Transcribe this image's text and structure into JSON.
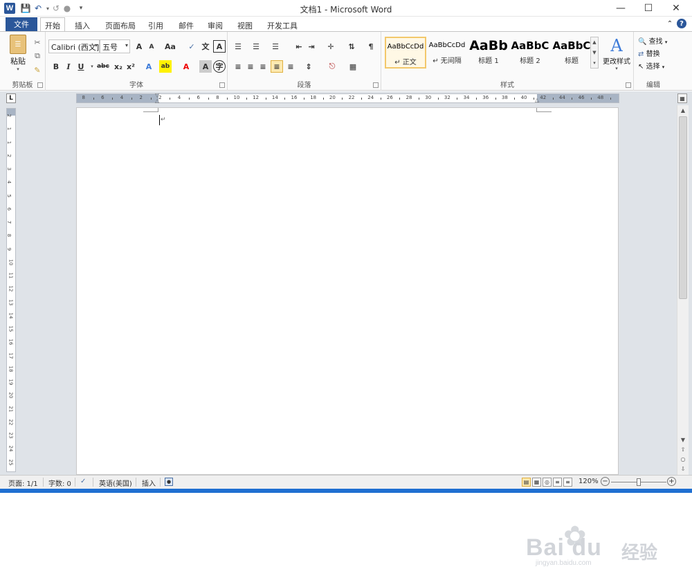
{
  "window": {
    "title": "文档1  -  Microsoft Word",
    "app_icon": "W"
  },
  "quick_access": {
    "items": [
      "save-icon",
      "undo-icon",
      "redo-icon",
      "repeat-icon",
      "customize-icon"
    ]
  },
  "tabs": {
    "file": "文件",
    "items": [
      "开始",
      "插入",
      "页面布局",
      "引用",
      "邮件",
      "审阅",
      "视图",
      "开发工具"
    ],
    "active": 0
  },
  "clipboard": {
    "paste": "粘贴",
    "label": "剪贴板"
  },
  "font": {
    "name": "Calibri (西文]",
    "size": "五号",
    "grow": "A",
    "shrink": "A",
    "case": "Aa",
    "pinyin": "文",
    "bold": "B",
    "italic": "I",
    "underline": "U",
    "strike": "abc",
    "sub": "x₂",
    "sup": "x²",
    "color_a": "A",
    "label": "字体"
  },
  "paragraph": {
    "label": "段落"
  },
  "styles": {
    "items": [
      {
        "preview": "AaBbCcDd",
        "name": "↵ 正文"
      },
      {
        "preview": "AaBbCcDd",
        "name": "↵ 无间隔"
      },
      {
        "preview": "AaBb",
        "name": "标题 1"
      },
      {
        "preview": "AaBbC",
        "name": "标题 2"
      },
      {
        "preview": "AaBbC",
        "name": "标题"
      }
    ],
    "selected": 0,
    "change": "更改样式",
    "label": "样式"
  },
  "editing": {
    "find": "查找",
    "replace": "替换",
    "select": "选择",
    "label": "编辑"
  },
  "ruler": {
    "numbers": [
      "8",
      "6",
      "4",
      "2",
      "2",
      "4",
      "6",
      "8",
      "10",
      "12",
      "14",
      "16",
      "18",
      "20",
      "22",
      "24",
      "26",
      "28",
      "30",
      "32",
      "34",
      "36",
      "38",
      "40",
      "42",
      "44",
      "46",
      "48"
    ],
    "vnumbers": [
      "2",
      "1",
      "1",
      "2",
      "3",
      "4",
      "5",
      "6",
      "7",
      "8",
      "9",
      "10",
      "11",
      "12",
      "13",
      "14",
      "15",
      "16",
      "17",
      "18",
      "19",
      "20",
      "21",
      "22",
      "23",
      "24",
      "25"
    ]
  },
  "status": {
    "page": "页面: 1/1",
    "words": "字数: 0",
    "language": "英语(美国)",
    "mode": "插入",
    "zoom": "120%",
    "zoom_level": 0.5
  },
  "watermark": {
    "brand": "Bai  du",
    "cn": "经验",
    "url": "jingyan.baidu.com"
  }
}
